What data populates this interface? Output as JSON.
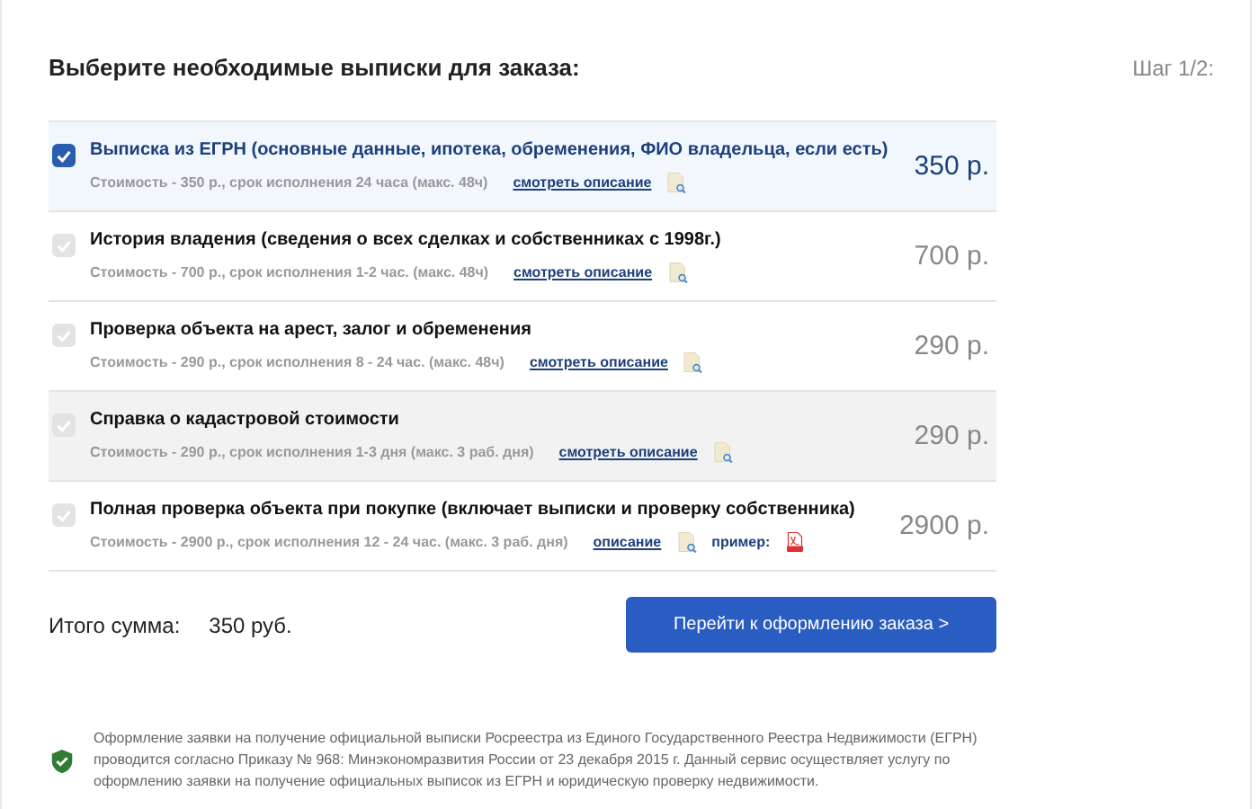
{
  "heading": "Выберите необходимые выписки для заказа:",
  "step": "Шаг 1/2:",
  "items": [
    {
      "title": "Выписка из ЕГРН (основные данные, ипотека, обременения, ФИО владельца, если есть)",
      "details": "Стоимость - 350 р., срок исполнения 24 часа (макс. 48ч)",
      "link": "смотреть описание",
      "price": "350 р.",
      "selected": true,
      "hovered": false
    },
    {
      "title": "История владения (сведения о всех сделках и собственниках с 1998г.)",
      "details": "Стоимость - 700 р., срок исполнения 1-2 час. (макс. 48ч)",
      "link": "смотреть описание",
      "price": "700 р.",
      "selected": false,
      "hovered": false
    },
    {
      "title": "Проверка объекта на арест, залог и обременения",
      "details": "Стоимость - 290 р., срок исполнения 8 - 24 час. (макс. 48ч)",
      "link": "смотреть описание",
      "price": "290 р.",
      "selected": false,
      "hovered": false
    },
    {
      "title": "Справка о кадастровой стоимости",
      "details": "Стоимость - 290 р., срок исполнения 1-3 дня (макс. 3 раб. дня)",
      "link": "смотреть описание",
      "price": "290 р.",
      "selected": false,
      "hovered": true
    },
    {
      "title": "Полная проверка объекта при покупке (включает выписки и проверку собственника)",
      "details": "Стоимость - 2900 р., срок исполнения 12 - 24 час. (макс. 3 раб. дня)",
      "link": "описание",
      "example": "пример:",
      "price": "2900 р.",
      "selected": false,
      "hovered": false
    }
  ],
  "total": {
    "label": "Итого сумма:",
    "value": "350 руб."
  },
  "button": "Перейти к оформлению заказа >",
  "note": "Оформление заявки на получение официальной выписки Росреестра из Единого Государственного Реестра Недвижимости (ЕГРН) проводится согласно Приказу № 968: Минэкономразвития России от 23 декабря 2015 г. Данный сервис осуществляет услугу по оформлению заявки на получение официальных выписок из ЕГРН и юридическую проверку недвижимости."
}
